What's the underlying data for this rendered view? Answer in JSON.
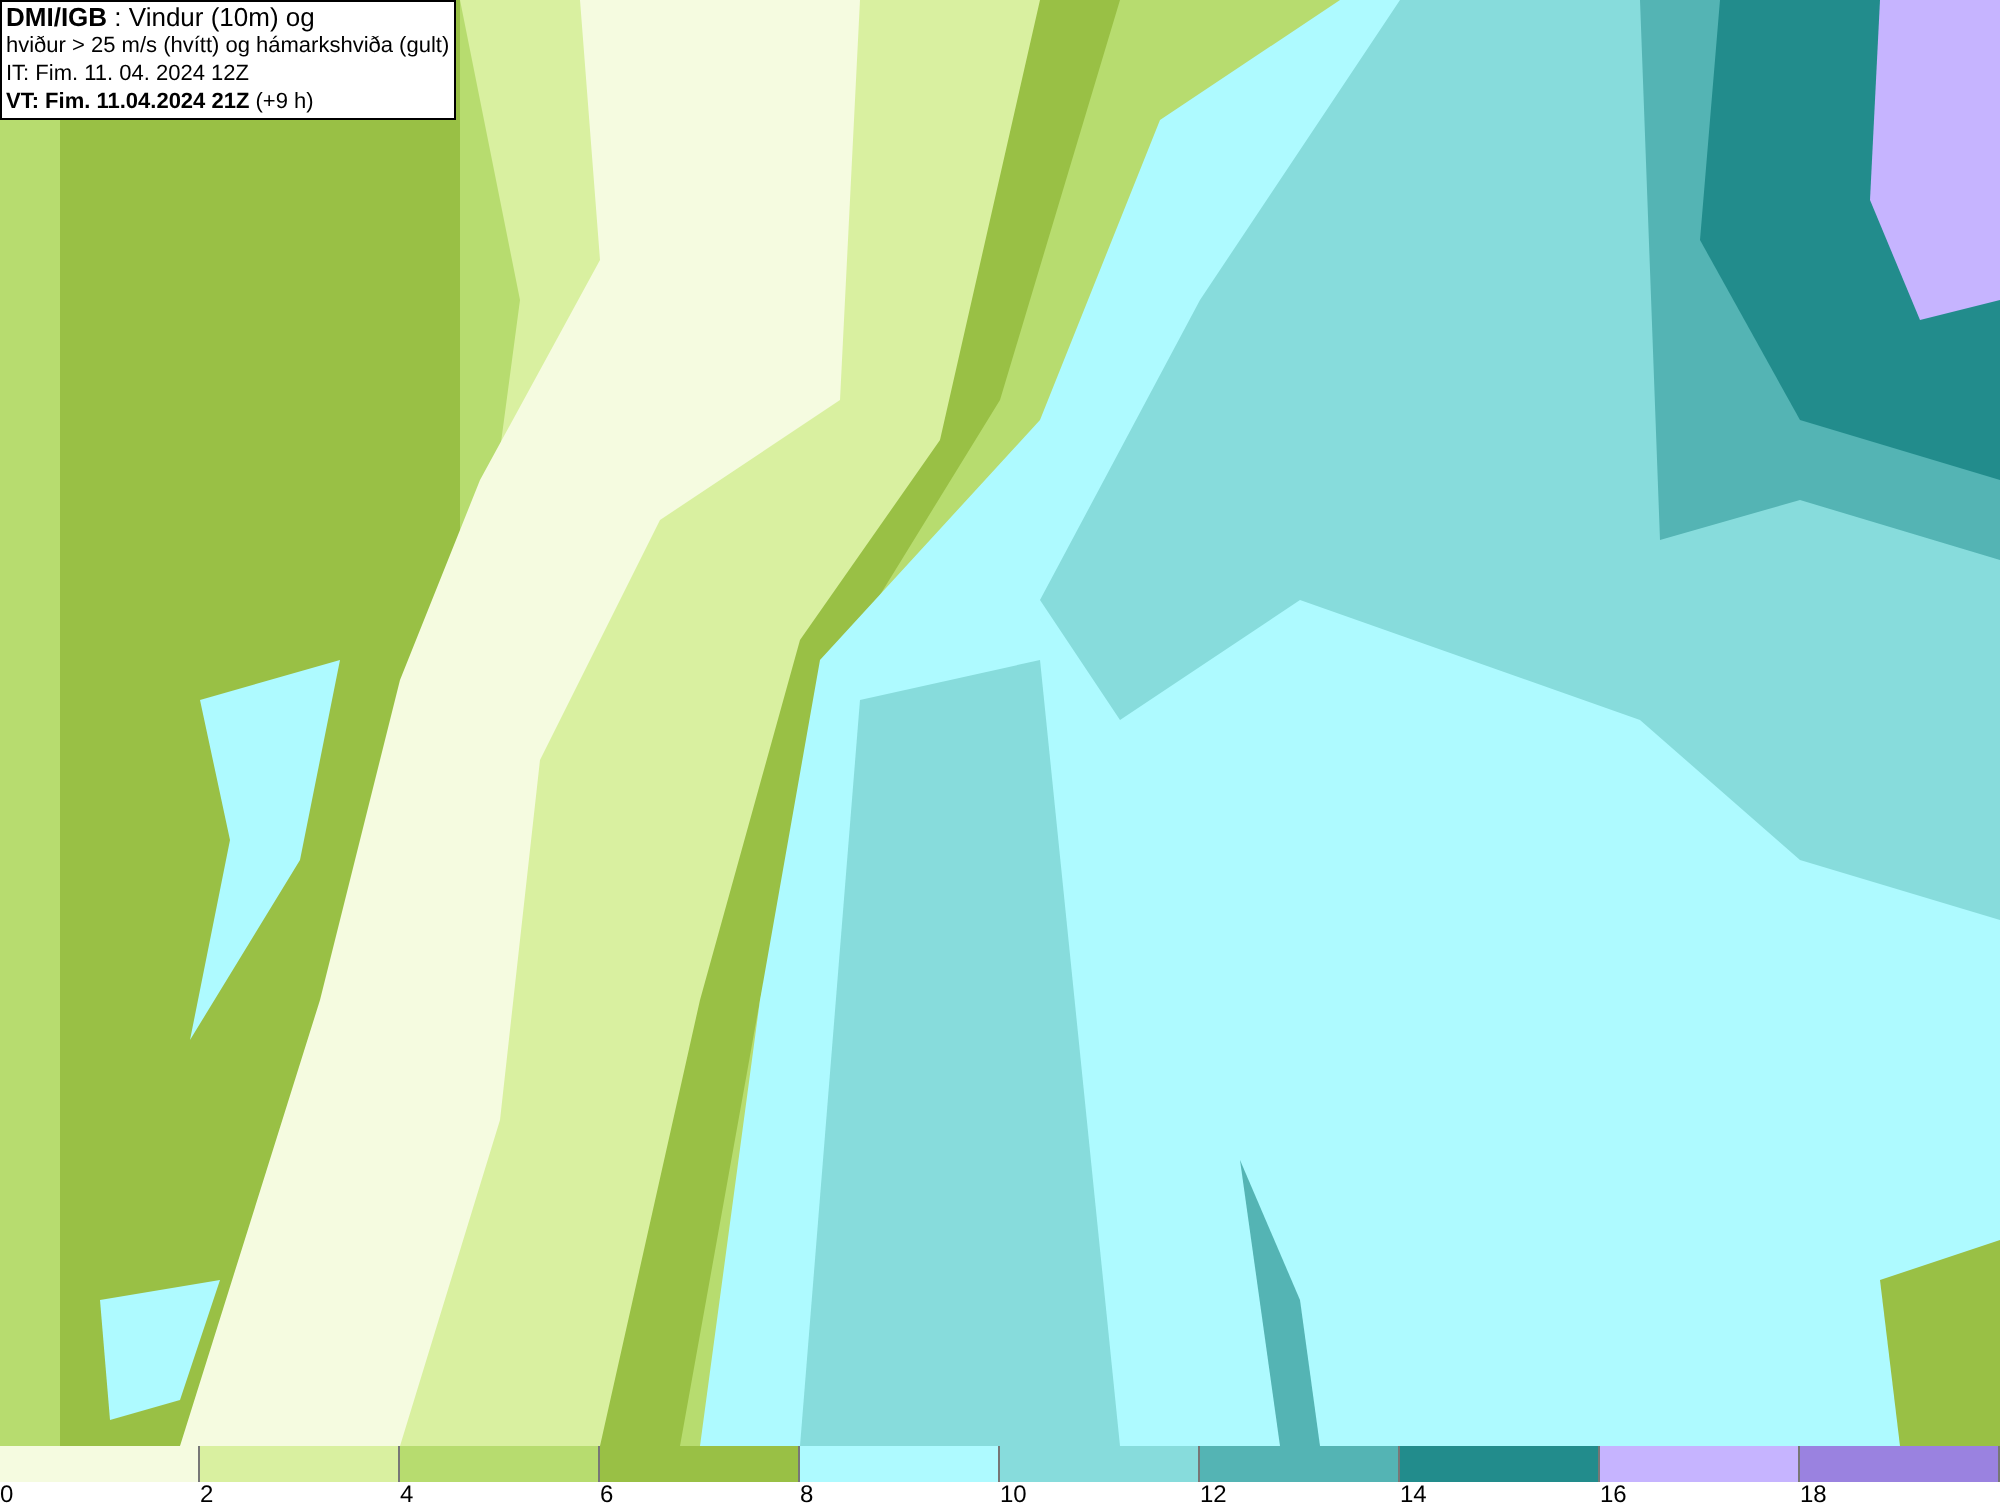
{
  "title_box": {
    "lines": [
      "**DMI/IGB** : Vindur (10m) og",
      "hviður > 25 m/s (hvítt) og hámarkshviða (gult)",
      "IT: Fim. 11. 04. 2024 12Z",
      "**VT: Fim. 11.04.2024 21Z** (+9 h)"
    ]
  },
  "legend": [
    {
      "label": "0",
      "color": "#f5fbe0"
    },
    {
      "label": "2",
      "color": "#d9f0a0"
    },
    {
      "label": "4",
      "color": "#b7dc6f"
    },
    {
      "label": "6",
      "color": "#99c045"
    },
    {
      "label": "8",
      "color": "#aefaff"
    },
    {
      "label": "10",
      "color": "#87dcdc"
    },
    {
      "label": "12",
      "color": "#54b4b4"
    },
    {
      "label": "14",
      "color": "#228c8c"
    },
    {
      "label": "16",
      "color": "#c6b4ff"
    },
    {
      "label": "18",
      "color": "#9a82e0"
    }
  ]
}
